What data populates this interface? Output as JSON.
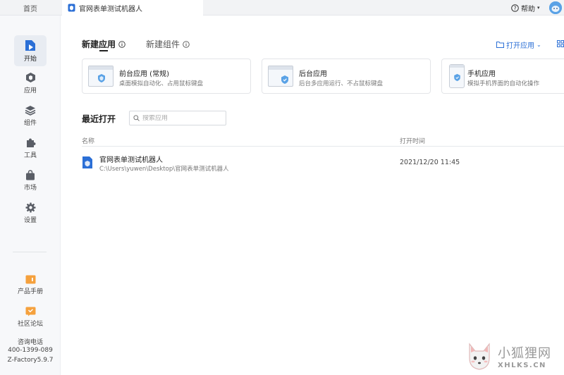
{
  "topbar": {
    "home_tab": "首页",
    "doc_tab": "官网表单测试机器人",
    "help": "帮助"
  },
  "sidebar": {
    "items": [
      {
        "label": "开始",
        "icon": "start-icon",
        "active": true
      },
      {
        "label": "应用",
        "icon": "cube-icon"
      },
      {
        "label": "组件",
        "icon": "layers-icon"
      },
      {
        "label": "工具",
        "icon": "puzzle-icon"
      },
      {
        "label": "市场",
        "icon": "bag-icon"
      },
      {
        "label": "设置",
        "icon": "gear-icon"
      }
    ],
    "footer": {
      "manual": "产品手册",
      "forum": "社区论坛",
      "hotline_label": "咨询电话",
      "hotline": "400-1399-089",
      "version": "Z-Factory5.9.7"
    }
  },
  "main": {
    "tabs": [
      {
        "label": "新建应用",
        "active": true
      },
      {
        "label": "新建组件",
        "active": false
      }
    ],
    "open_app": "打开应用",
    "cards": [
      {
        "title": "前台应用 (常规)",
        "desc": "桌面模拟自动化、占用鼠标键盘"
      },
      {
        "title": "后台应用",
        "desc": "后台多应用运行、不占鼠标键盘"
      },
      {
        "title": "手机应用",
        "desc": "模拟手机界面的自动化操作"
      }
    ],
    "recent": {
      "title": "最近打开",
      "search_placeholder": "搜索应用",
      "columns": {
        "name": "名称",
        "time": "打开时间"
      },
      "rows": [
        {
          "name": "官网表单测试机器人",
          "path": "C:\\Users\\yuwen\\Desktop\\官网表单测试机器人",
          "time": "2021/12/20 11:45"
        }
      ]
    }
  },
  "watermark": {
    "cn": "小狐狸网",
    "en": "XHLKS.CN"
  },
  "colors": {
    "accent": "#2b6fd6",
    "sidebar_bg": "#f7f8fa",
    "topbar_bg": "#f2f3f5",
    "icon_gray": "#5a5e66",
    "orange": "#f5a13d"
  }
}
